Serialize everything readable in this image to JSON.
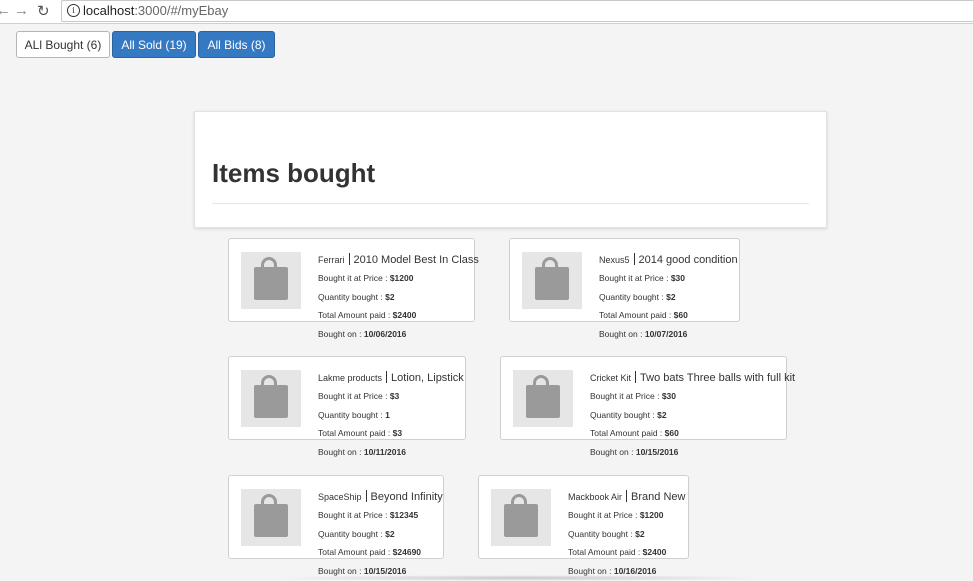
{
  "browser": {
    "back_icon": "←",
    "forward_icon": "→",
    "reload_icon": "↻",
    "info_icon": "i",
    "url_host": "localhost",
    "url_path": ":3000/#/myEbay"
  },
  "tabs": {
    "bought": "ALl Bought (6)",
    "sold": "All Sold (19)",
    "bids": "All Bids (8)"
  },
  "panel": {
    "title": "Items bought"
  },
  "labels": {
    "price": "Bought it at Price : ",
    "qty": "Quantity bought : ",
    "total": "Total Amount paid : ",
    "date": "Bought on : "
  },
  "items": [
    {
      "name": "Ferrari",
      "desc": "2010 Model Best In Class",
      "price": "$1200",
      "qty": "$2",
      "total": "$2400",
      "date": "10/06/2016"
    },
    {
      "name": "Nexus5",
      "desc": "2014 good condition",
      "price": "$30",
      "qty": "$2",
      "total": "$60",
      "date": "10/07/2016"
    },
    {
      "name": "Lakme products",
      "desc": "Lotion, Lipstick",
      "price": "$3",
      "qty": "1",
      "total": "$3",
      "date": "10/11/2016"
    },
    {
      "name": "Cricket Kit",
      "desc": "Two bats Three balls with full kit",
      "price": "$30",
      "qty": "$2",
      "total": "$60",
      "date": "10/15/2016"
    },
    {
      "name": "SpaceShip",
      "desc": "Beyond Infinity",
      "price": "$12345",
      "qty": "$2",
      "total": "$24690",
      "date": "10/15/2016"
    },
    {
      "name": "Mackbook Air",
      "desc": "Brand New",
      "price": "$1200",
      "qty": "$2",
      "total": "$2400",
      "date": "10/16/2016"
    }
  ]
}
